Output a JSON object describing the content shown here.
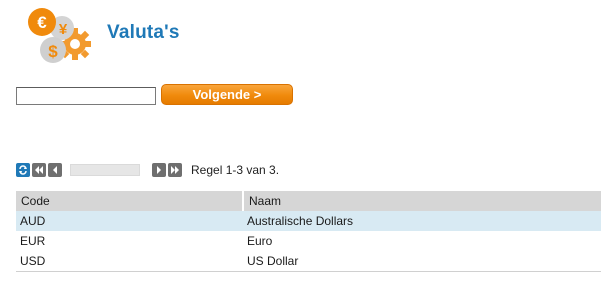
{
  "header": {
    "title": "Valuta's",
    "logo_icon": "currency-exchange-icon",
    "logo_symbols": [
      "€",
      "¥",
      "$"
    ]
  },
  "search": {
    "value": "",
    "placeholder": ""
  },
  "actions": {
    "next_label": "Volgende >"
  },
  "pager": {
    "icons": [
      "refresh-icon",
      "first-page-icon",
      "prev-page-icon",
      "next-page-icon",
      "last-page-icon"
    ],
    "info": "Regel 1-3 van 3."
  },
  "table": {
    "columns": [
      "Code",
      "Naam"
    ],
    "rows": [
      {
        "code": "AUD",
        "name": "Australische Dollars",
        "selected": true
      },
      {
        "code": "EUR",
        "name": "Euro",
        "selected": false
      },
      {
        "code": "USD",
        "name": "US Dollar",
        "selected": false
      }
    ]
  },
  "colors": {
    "accent_blue": "#1f79b7",
    "button_orange": "#f08a0c",
    "selected_row": "#d8eaf3",
    "header_gray": "#d6d6d6"
  }
}
